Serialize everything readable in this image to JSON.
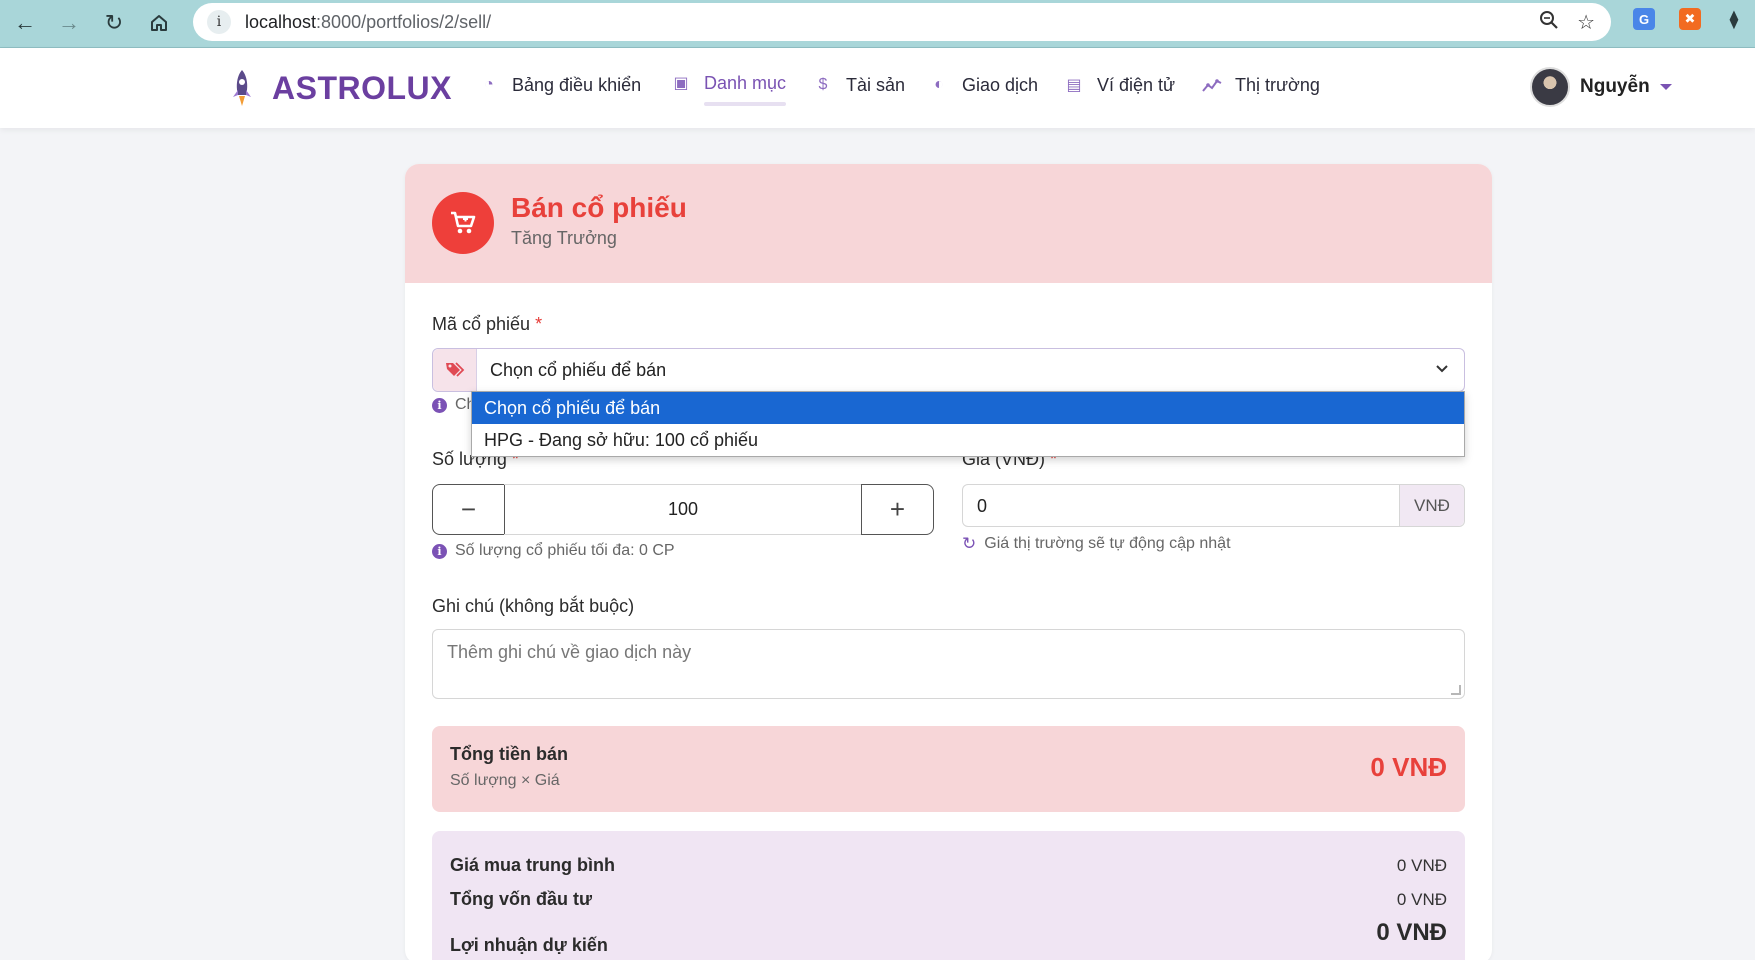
{
  "browser": {
    "url_host": "localhost",
    "url_path": ":8000/portfolios/2/sell/"
  },
  "header": {
    "brand": "ASTROLUX",
    "nav": [
      {
        "label": "Bảng điều khiển",
        "icon": "dashboard-icon"
      },
      {
        "label": "Danh mục",
        "icon": "folder-icon",
        "active": true
      },
      {
        "label": "Tài sản",
        "icon": "moneybag-icon"
      },
      {
        "label": "Giao dịch",
        "icon": "coin-icon"
      },
      {
        "label": "Ví điện tử",
        "icon": "wallet-icon"
      },
      {
        "label": "Thị trường",
        "icon": "chart-line-icon"
      }
    ],
    "user_name": "Nguyễn"
  },
  "colors": {
    "brand": "#6b3fa0",
    "accent_red": "#e8413b",
    "header_pink": "#f7d6d8",
    "summary_lilac": "#f0e5f3",
    "selected_option": "#1967d2"
  },
  "form": {
    "title": "Bán cổ phiếu",
    "subtitle": "Tăng Trưởng",
    "stock_label": "Mã cổ phiếu",
    "required_mark": "*",
    "stock_selected": "Chọn cổ phiếu để bán",
    "stock_hint_partial": "Ch",
    "stock_options": [
      "Chọn cổ phiếu để bán",
      "HPG - Đang sở hữu: 100 cổ phiếu"
    ],
    "quantity_label": "Số lượng",
    "quantity_value": "100",
    "quantity_minus": "−",
    "quantity_plus": "+",
    "quantity_hint": "Số lượng cổ phiếu tối đa: 0 CP",
    "price_label": "Giá (VNĐ)",
    "price_value": "0",
    "price_unit": "VNĐ",
    "price_hint": "Giá thị trường sẽ tự động cập nhật",
    "note_label": "Ghi chú (không bắt buộc)",
    "note_placeholder": "Thêm ghi chú về giao dịch này"
  },
  "total": {
    "label": "Tổng tiền bán",
    "formula": "Số lượng × Giá",
    "amount": "0 VNĐ"
  },
  "summary": {
    "avg_buy_label": "Giá mua trung bình",
    "avg_buy_value": "0 VNĐ",
    "invested_label": "Tổng vốn đầu tư",
    "invested_value": "0 VNĐ",
    "profit_label": "Lợi nhuận dự kiến",
    "profit_value": "0 VNĐ"
  }
}
